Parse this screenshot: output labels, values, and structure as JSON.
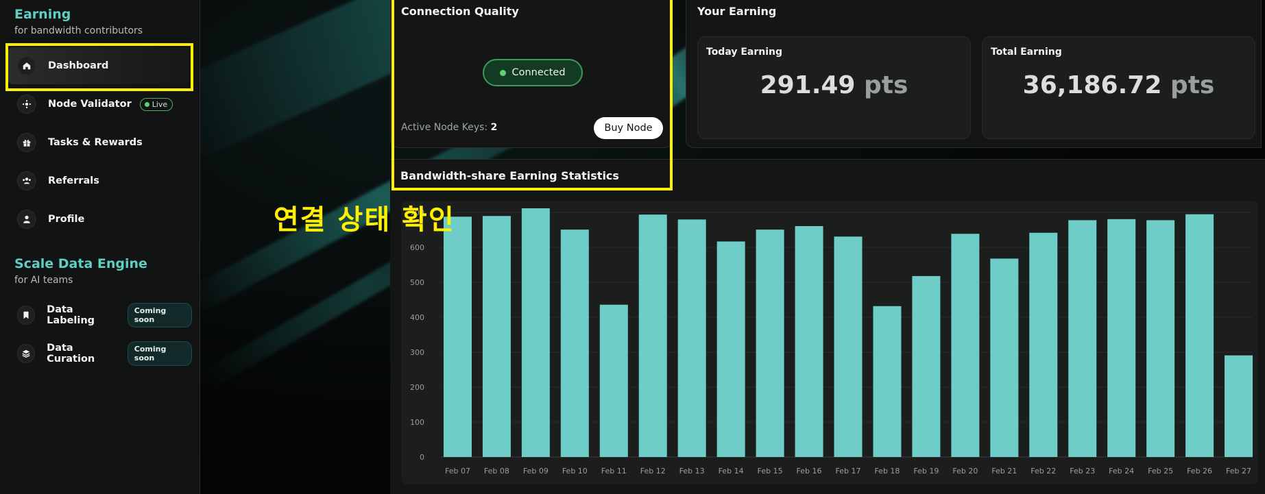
{
  "sidebar": {
    "earning_title": "Earning",
    "earning_sub": "for bandwidth contributors",
    "items": [
      {
        "label": "Dashboard"
      },
      {
        "label": "Node Validator",
        "badge": "Live"
      },
      {
        "label": "Tasks & Rewards"
      },
      {
        "label": "Referrals"
      },
      {
        "label": "Profile"
      }
    ],
    "scale_title": "Scale Data Engine",
    "scale_sub": "for AI teams",
    "scale_items": [
      {
        "label": "Data Labeling",
        "badge": "Coming soon"
      },
      {
        "label": "Data Curation",
        "badge": "Coming soon"
      }
    ]
  },
  "connection": {
    "title": "Connection Quality",
    "status": "Connected",
    "keys_label": "Active Node Keys:",
    "keys_value": "2",
    "buy_label": "Buy Node"
  },
  "earning": {
    "title": "Your Earning",
    "today_label": "Today Earning",
    "today_value": "291.49",
    "today_unit": "pts",
    "total_label": "Total Earning",
    "total_value": "36,186.72",
    "total_unit": "pts"
  },
  "stats": {
    "title": "Bandwidth-share Earning Statistics"
  },
  "annotation": "연결 상태 확인",
  "colors": {
    "accent": "#5fcfc3",
    "bar": "#6ecdc6",
    "highlight": "#ffef00",
    "connected": "#5fd07a"
  },
  "chart_data": {
    "type": "bar",
    "categories": [
      "Feb 07",
      "Feb 08",
      "Feb 09",
      "Feb 10",
      "Feb 11",
      "Feb 12",
      "Feb 13",
      "Feb 14",
      "Feb 15",
      "Feb 16",
      "Feb 17",
      "Feb 18",
      "Feb 19",
      "Feb 20",
      "Feb 21",
      "Feb 22",
      "Feb 23",
      "Feb 24",
      "Feb 25",
      "Feb 26",
      "Feb 27"
    ],
    "values": [
      688,
      690,
      712,
      651,
      436,
      694,
      680,
      617,
      651,
      661,
      631,
      432,
      518,
      639,
      568,
      642,
      678,
      681,
      678,
      695,
      291
    ],
    "title": "",
    "xlabel": "",
    "ylabel": "",
    "ylim": [
      0,
      700
    ],
    "yticks": [
      0,
      100,
      200,
      300,
      400,
      500,
      600,
      700
    ],
    "grid": true
  }
}
